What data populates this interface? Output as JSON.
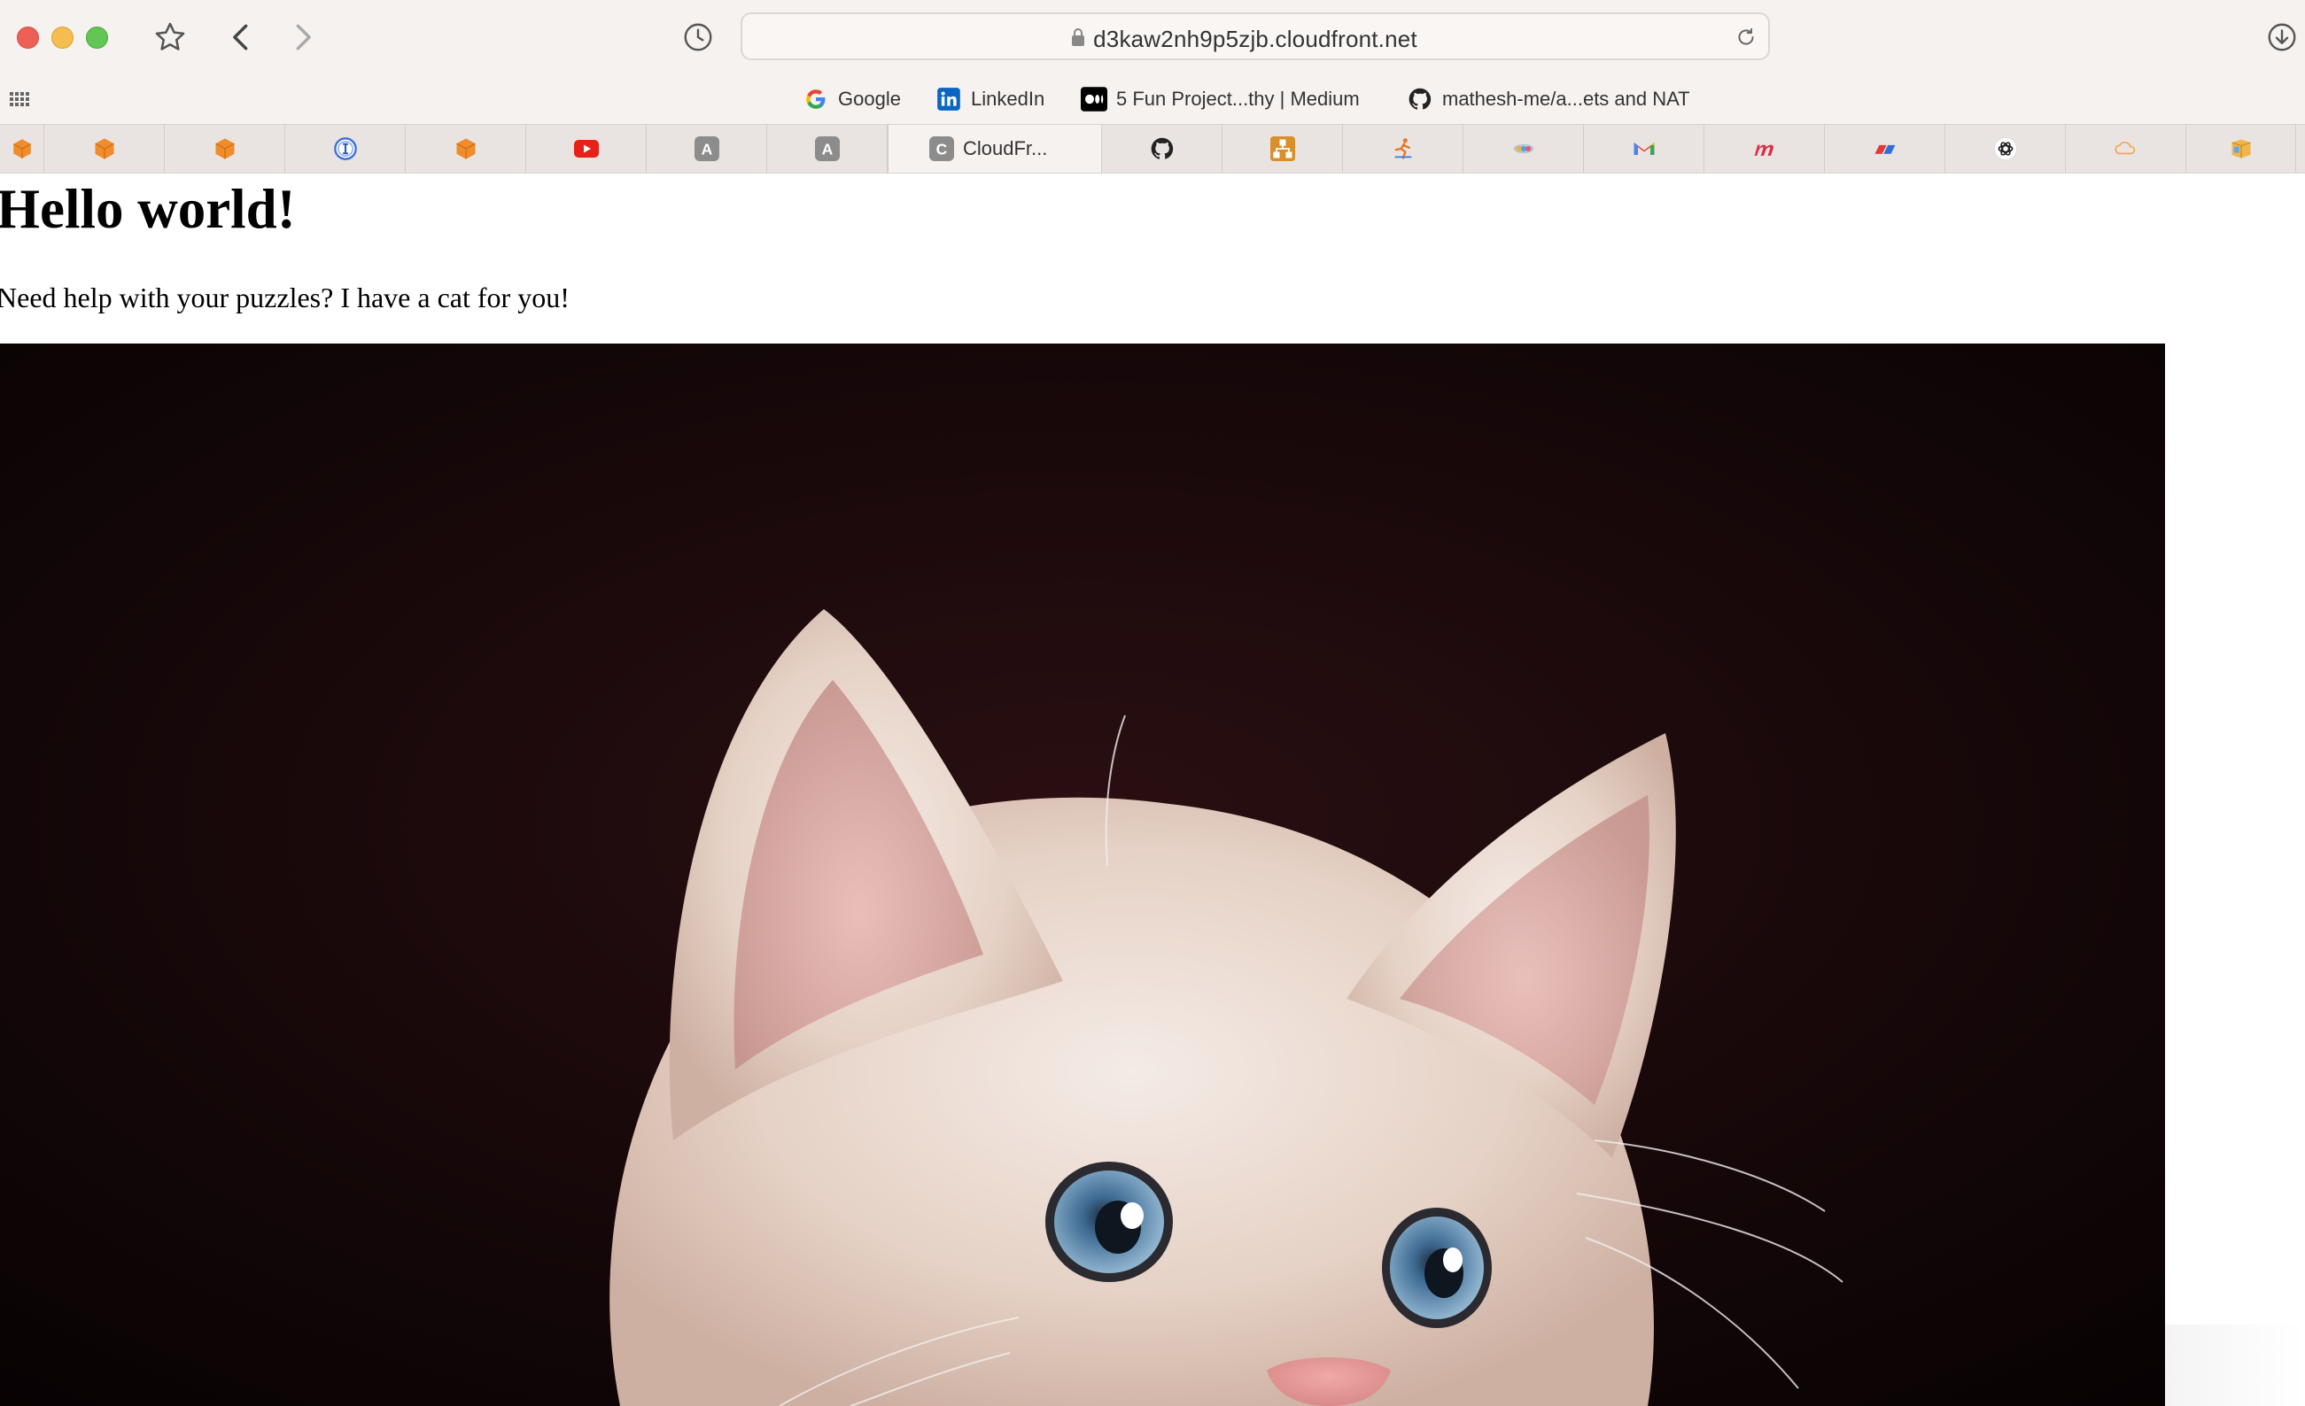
{
  "browser": {
    "url": "d3kaw2nh9p5zjb.cloudfront.net",
    "favorites": [
      {
        "label": "Google",
        "icon": "google-icon"
      },
      {
        "label": "LinkedIn",
        "icon": "linkedin-icon"
      },
      {
        "label": "5 Fun Project...thy | Medium",
        "icon": "medium-icon"
      },
      {
        "label": "mathesh-me/a...ets and NAT",
        "icon": "github-icon"
      }
    ],
    "tabs": {
      "active_label": "CloudFr...",
      "active_badge": "C",
      "badge_a": "A",
      "icons": [
        "aws-cube-icon",
        "aws-cube-icon",
        "aws-cube-icon",
        "info-circle-icon",
        "aws-cube-icon",
        "youtube-icon",
        "letter-a-icon",
        "letter-a-icon",
        "cloudfront-icon",
        "github-icon",
        "diagram-icon",
        "runner-icon",
        "colorful-icon",
        "gmail-icon",
        "m-logo-icon",
        "flag-icon",
        "chatgpt-icon",
        "cloud-icon",
        "box-icon"
      ]
    },
    "colors": {
      "chrome": "#f6f2ef",
      "tabbar": "#e9e4e1",
      "aws_orange": "#f08c2b",
      "youtube_red": "#e62117",
      "google_blue": "#4285f4"
    }
  },
  "page": {
    "heading": "Hello world!",
    "intro": "Need help with your puzzles? I have a cat for you!",
    "image_alt": "kitten photo"
  }
}
